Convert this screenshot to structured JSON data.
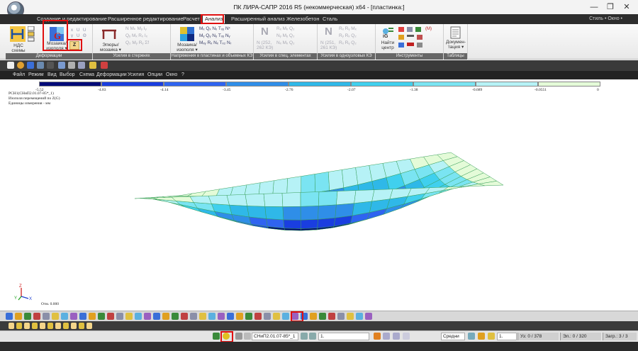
{
  "window": {
    "title": "ПК ЛИРА-САПР  2016 R5 (некоммерческая) x64 - [пластинка:]",
    "minimize": "—",
    "maximize": "❐",
    "close": "✕"
  },
  "ribbon_tabs": [
    {
      "label": "Создание и редактирование"
    },
    {
      "label": "Расширенное редактирование"
    },
    {
      "label": "Расчет"
    },
    {
      "label": "Анализ",
      "active": true
    },
    {
      "label": "Расширенный анализ"
    },
    {
      "label": "Железобетон"
    },
    {
      "label": "Сталь"
    }
  ],
  "ribbon_right": "Стиль • Окно •",
  "ribbon": {
    "deform": {
      "group_label": "Деформации",
      "nds_label": "НДС схемы ▾",
      "mosaic_label": "Мозаика/ изополя ▾",
      "z_label": "Z"
    },
    "rods": {
      "group_label": "Усилия в стержнях",
      "epure_label": "Эпюры/ мозаика ▾",
      "ghost": [
        "N  Mₖ  Mᵧ  Iᵧ",
        "Qᵧ  Mₓ  Rₓ  Iₓ",
        "Q₂  Mᵧ  Rᵧ  Σf"
      ]
    },
    "plates": {
      "group_label": "Напряжения в пластинах и объемных КЭ",
      "mosaic_label": "Мозаика/ изополя ▾",
      "ghost": [
        "Mₓ  Qₓ  Nₓ  Tₓᵧ  Nˣ",
        "Mᵧ  Qᵧ  Nᵧ  Tₓᵧ  Nᵧ",
        "Mₓᵧ  Rₓ  Nₓ  Tₓ₂  Nᵣ"
      ]
    },
    "special": {
      "group_label": "Усилия в спец. элементах",
      "n_label": "N",
      "n_sub": "N (252, 262 КЭ)",
      "ghost": [
        "Rₓ  Mₓ  Q₂",
        "Nᵧ  Mᵧ  Q₂",
        "Nₓ  Mₓ  Q₂"
      ]
    },
    "single_node": {
      "group_label": "Усилия в одноузловых КЭ",
      "n_label": "N",
      "n_sub": "N (251, 261 КЭ)",
      "ghost": [
        "Rₓ  Rᵧ  Mₓ",
        "Rᵧ  Rₓ  Q₂",
        "Rₓ  Rᵧ  Q₂"
      ]
    },
    "tools": {
      "group_label": "Инструменты",
      "find_label": "Найти центр"
    },
    "tables": {
      "group_label": "Таблицы",
      "doc_label": "Докумен- тация ▾"
    }
  },
  "menubar": [
    {
      "label": "Файл"
    },
    {
      "label": "Режим"
    },
    {
      "label": "Вид"
    },
    {
      "label": "Выбор"
    },
    {
      "label": "Схема"
    },
    {
      "label": "Деформации"
    },
    {
      "label": "Усилия"
    },
    {
      "label": "Опции"
    },
    {
      "label": "Окно"
    },
    {
      "label": "?"
    }
  ],
  "legend": {
    "colors": [
      "#000a78",
      "#1a3ee0",
      "#2f64f0",
      "#2f8ee8",
      "#2fb8e8",
      "#40d0ee",
      "#7ae4f2",
      "#b6f2f6",
      "#e4fbd8"
    ],
    "ticks": [
      "-5.52",
      "-4.83",
      "-4.14",
      "-3.45",
      "-2.76",
      "-2.07",
      "-1.38",
      "-0.689",
      "-0.0551",
      "0"
    ]
  },
  "info": {
    "line1": "РСН1(СНиП2.01.07-85*_1)",
    "line2": "Изополя перемещений по Z(G)",
    "line3": "Единицы измерения - мм"
  },
  "axes": {
    "z": "Z",
    "y": "Y",
    "x": "X"
  },
  "scale_label": "Отм. 0.000",
  "statusbar": {
    "norm_value": "СНиП2.01.07-85*_1",
    "load_value": "1.",
    "mode_value": "Средни",
    "scale_value": "1.",
    "nodes": "Уз: 0 / 378",
    "elements": "Эл.: 0 / 320",
    "loads": "Загр.: 3 / 3"
  }
}
